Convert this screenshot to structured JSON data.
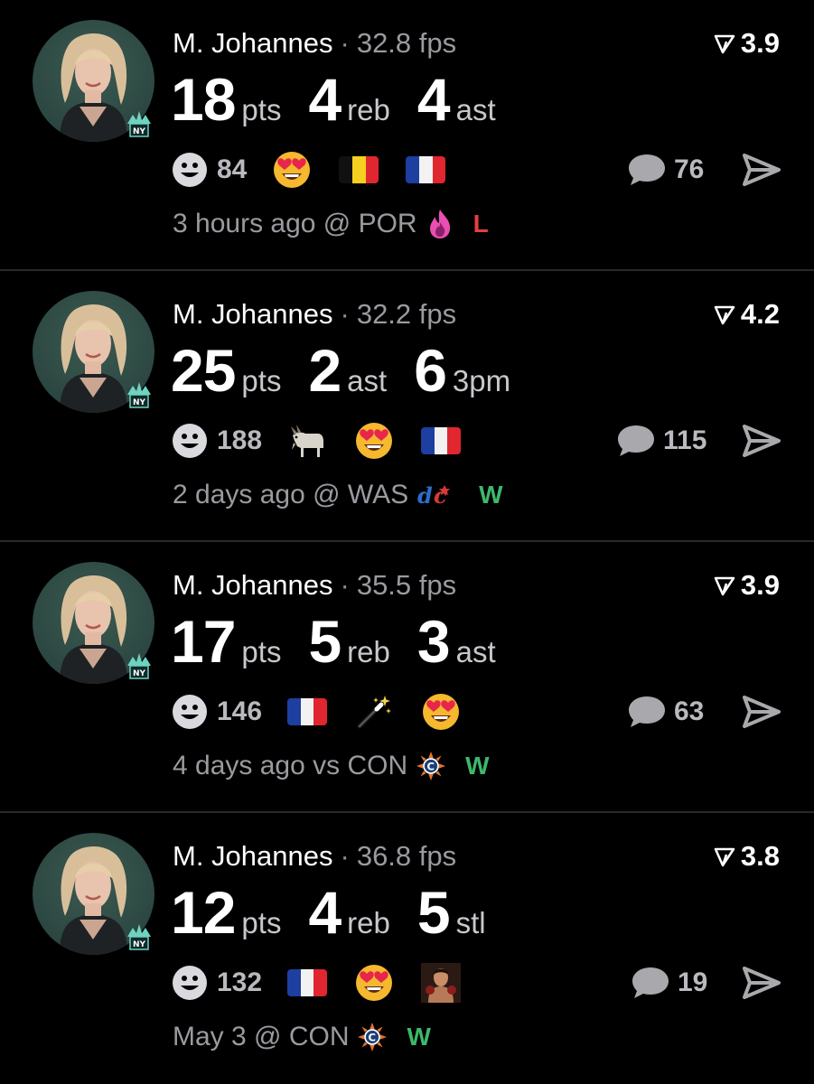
{
  "colors": {
    "background": "#000000",
    "divider": "#2a2a2c",
    "loss": "#e53e3e",
    "win": "#3db86b",
    "secondary_text": "#9a9aa0"
  },
  "posts": [
    {
      "player_name": "M. Johannes",
      "separator": "·",
      "fps": "32.8 fps",
      "rating": "3.9",
      "stats": [
        {
          "value": "18",
          "unit": "pts"
        },
        {
          "value": "4",
          "unit": "reb"
        },
        {
          "value": "4",
          "unit": "ast"
        }
      ],
      "reaction_count": "84",
      "reaction_emojis": [
        "heart-eyes-emoji",
        "belgium-flag",
        "france-flag"
      ],
      "comment_count": "76",
      "game_time": "3 hours ago @ POR",
      "opponent_logo": "portland-fire-logo",
      "result": "L"
    },
    {
      "player_name": "M. Johannes",
      "separator": "·",
      "fps": "32.2 fps",
      "rating": "4.2",
      "stats": [
        {
          "value": "25",
          "unit": "pts"
        },
        {
          "value": "2",
          "unit": "ast"
        },
        {
          "value": "6",
          "unit": "3pm"
        }
      ],
      "reaction_count": "188",
      "reaction_emojis": [
        "goat-emoji",
        "heart-eyes-emoji",
        "france-flag"
      ],
      "comment_count": "115",
      "game_time": "2 days ago @ WAS",
      "opponent_logo": "washington-mystics-logo",
      "result": "W"
    },
    {
      "player_name": "M. Johannes",
      "separator": "·",
      "fps": "35.5 fps",
      "rating": "3.9",
      "stats": [
        {
          "value": "17",
          "unit": "pts"
        },
        {
          "value": "5",
          "unit": "reb"
        },
        {
          "value": "3",
          "unit": "ast"
        }
      ],
      "reaction_count": "146",
      "reaction_emojis": [
        "france-flag",
        "magic-wand-emoji",
        "heart-eyes-emoji"
      ],
      "comment_count": "63",
      "game_time": "4 days ago vs CON",
      "opponent_logo": "connecticut-sun-logo",
      "result": "W"
    },
    {
      "player_name": "M. Johannes",
      "separator": "·",
      "fps": "36.8 fps",
      "rating": "3.8",
      "stats": [
        {
          "value": "12",
          "unit": "pts"
        },
        {
          "value": "4",
          "unit": "reb"
        },
        {
          "value": "5",
          "unit": "stl"
        }
      ],
      "reaction_count": "132",
      "reaction_emojis": [
        "france-flag",
        "heart-eyes-emoji",
        "fighter-sticker"
      ],
      "comment_count": "19",
      "game_time": "May 3 @ CON",
      "opponent_logo": "connecticut-sun-logo",
      "result": "W"
    }
  ]
}
